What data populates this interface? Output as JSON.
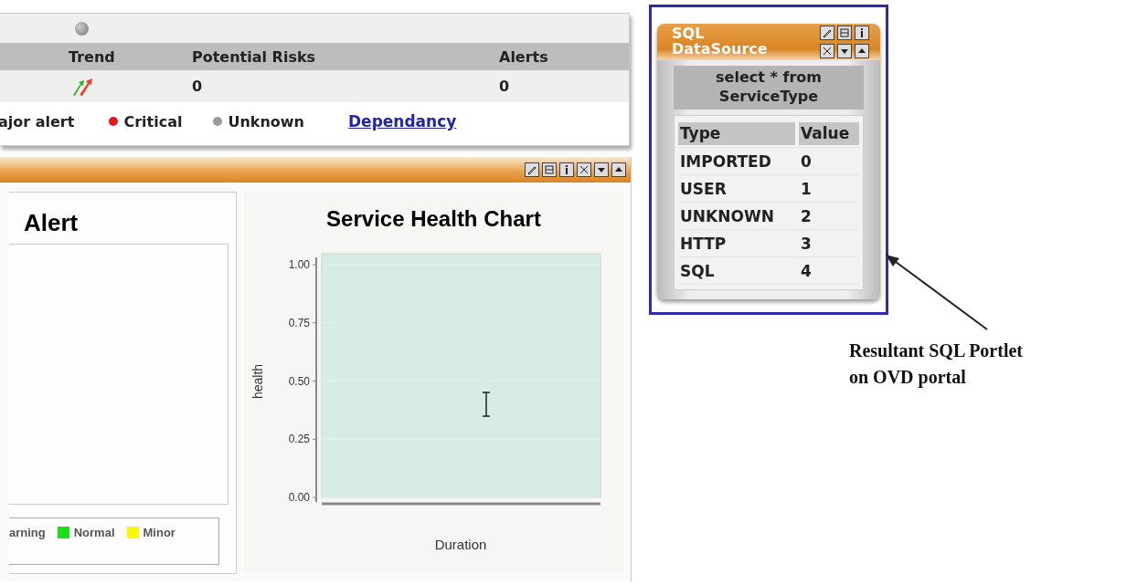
{
  "summary_panel": {
    "columns": [
      "Trend",
      "Potential Risks",
      "Alerts"
    ],
    "rows": [
      {
        "potential_risks": "0",
        "alerts": "0"
      }
    ],
    "legend": [
      {
        "label": "ajor alert"
      },
      {
        "label": "Critical",
        "color": "#e01818"
      },
      {
        "label": "Unknown",
        "color": "#9a9a9a"
      }
    ],
    "link": "Dependancy"
  },
  "dashboard_panel": {
    "alert_box": {
      "title": "Alert",
      "legend": [
        {
          "label": "arning"
        },
        {
          "label": "Normal",
          "color": "#18e018"
        },
        {
          "label": "Minor",
          "color": "#f8f800"
        }
      ]
    },
    "chart": {
      "title": "Service Health Chart",
      "xlabel": "Duration",
      "ylabel": "health",
      "y_tick_labels": [
        "1.00",
        "0.75",
        "0.50",
        "0.25",
        "0.00"
      ]
    }
  },
  "sql_portlet": {
    "title": "SQL DataSource",
    "query": "select * from ServiceType",
    "columns": [
      "Type",
      "Value"
    ],
    "rows": [
      {
        "type": "IMPORTED",
        "value": "0"
      },
      {
        "type": "USER",
        "value": "1"
      },
      {
        "type": "UNKNOWN",
        "value": "2"
      },
      {
        "type": "HTTP",
        "value": "3"
      },
      {
        "type": "SQL",
        "value": "4"
      }
    ]
  },
  "annotation": "Resultant SQL Portlet on OVD portal"
}
